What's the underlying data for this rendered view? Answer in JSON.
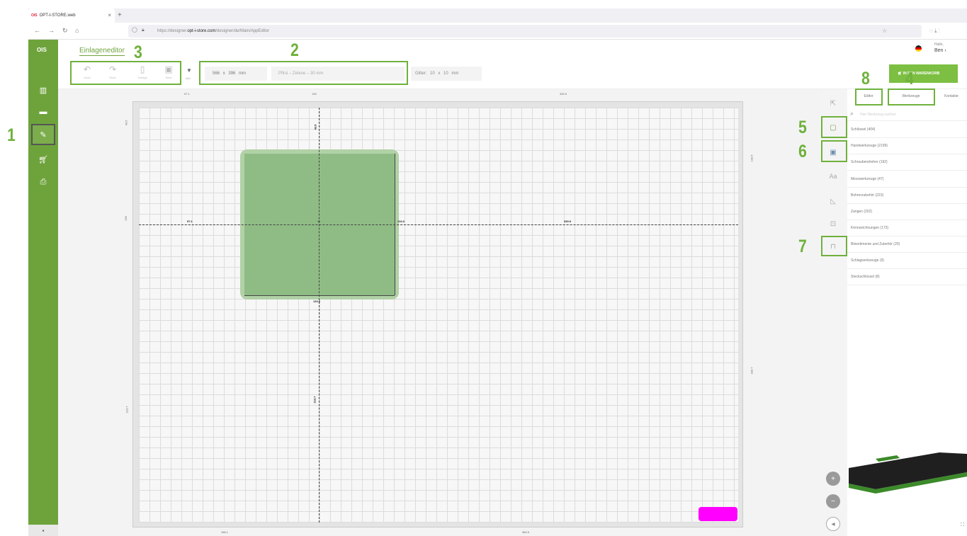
{
  "browser": {
    "tab_title": "OPT-I-STORE.web",
    "url_prefix": "https://designer.",
    "url_domain": "opt-i-store.com",
    "url_suffix": "/designer/de/Main/AppEditor"
  },
  "sidebar": {
    "logo": "OIS"
  },
  "header": {
    "title": "Einlageneditor",
    "greeting": "Hallo,",
    "user": "Ben"
  },
  "toolbar": {
    "tools": [
      {
        "label": "Undo",
        "icon": "undo-icon"
      },
      {
        "label": "Redo",
        "icon": "redo-icon"
      },
      {
        "label": "Vorlage",
        "icon": "template-icon"
      },
      {
        "label": "Save",
        "icon": "save-icon"
      }
    ],
    "dropdown_label": "Alle",
    "size_width": "566",
    "size_times": "x",
    "size_height": "396",
    "size_unit": "mm",
    "foam_placeholder": "Pfirsi – Zelene – 30 mm",
    "grid_label": "Gitter:",
    "grid_x": "10",
    "grid_times": "x",
    "grid_y": "10",
    "grid_unit": "mm",
    "cart_button": "IN DEN WARENKORB"
  },
  "annotations": [
    "1",
    "2",
    "3",
    "4",
    "5",
    "6",
    "7",
    "8"
  ],
  "canvas": {
    "ruler_top": [
      "97.1",
      "139",
      "330.9"
    ],
    "ruler_bottom": [
      "186.1",
      "360.5"
    ],
    "ruler_left": [
      "43.5",
      "139",
      "213.7"
    ],
    "ruler_right": [
      "132.5",
      "183.7"
    ],
    "dim_left": "97.1",
    "dim_right": "330.9",
    "dim_top": "43.5",
    "dim_bottom": "213.7",
    "dim_inner_right": "134.0",
    "dim_inner_bottom": "133.0",
    "center_label": "11",
    "highlight_color": "#ff00ff"
  },
  "right_panel": {
    "tabs": [
      "Editor",
      "Werkzeuge",
      "Kontakte"
    ],
    "search_placeholder": "Hier Werkzeug suchen",
    "categories": [
      "Schlüssel (404)",
      "Handwerkzeuge (2199)",
      "Schraubendreher (192)",
      "Messwerkzeuge (47)",
      "Bohrerzubehör (223)",
      "Zangen (202)",
      "Kennzeichnungen (173)",
      "Bitsortimente und Zubehör (20)",
      "Schlagwerkzeuge (9)",
      "Steckschlüssel (8)"
    ]
  },
  "colors": {
    "sidebar": "#6ea33c",
    "annotation": "#6fb13c",
    "shape": "#8fbc85"
  }
}
